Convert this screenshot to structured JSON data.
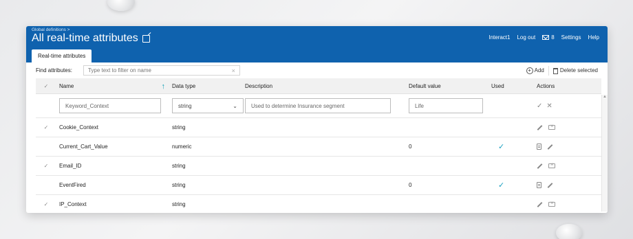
{
  "header": {
    "breadcrumb": "Global definitions >",
    "title": "All real-time attributes",
    "nav": {
      "user": "Interact1",
      "logout": "Log out",
      "mail_count": "8",
      "settings": "Settings",
      "help": "Help"
    },
    "tab": "Real-time attributes"
  },
  "toolbar": {
    "find_label": "Find attributes:",
    "filter_placeholder": "Type text to filter on name",
    "add_label": "Add",
    "delete_label": "Delete selected"
  },
  "table": {
    "columns": [
      "Name",
      "Data type",
      "Description",
      "Default value",
      "Used",
      "Actions"
    ],
    "edit_row": {
      "name": "Keyword_Context",
      "data_type": "string",
      "description": "Used to determine Insurance segment",
      "default_value": "Life"
    },
    "rows": [
      {
        "name": "Cookie_Context",
        "type": "string",
        "default": "",
        "checked": true,
        "used": false
      },
      {
        "name": "Current_Cart_Value",
        "type": "numeric",
        "default": "0",
        "checked": false,
        "used": true
      },
      {
        "name": "Email_ID",
        "type": "string",
        "default": "",
        "checked": true,
        "used": false
      },
      {
        "name": "EventFired",
        "type": "string",
        "default": "0",
        "checked": false,
        "used": true
      },
      {
        "name": "IP_Context",
        "type": "string",
        "default": "",
        "checked": true,
        "used": false
      }
    ]
  },
  "colors": {
    "brand": "#0f62ae",
    "accent": "#1aa0c0"
  }
}
